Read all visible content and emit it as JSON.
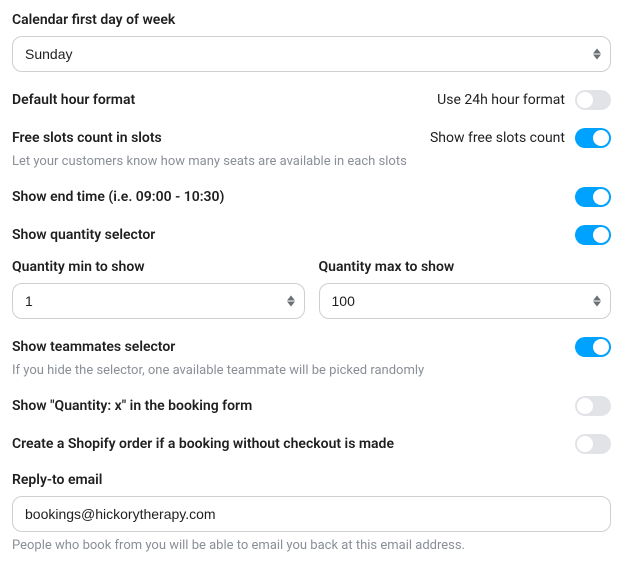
{
  "firstDay": {
    "label": "Calendar first day of week",
    "value": "Sunday"
  },
  "hourFormat": {
    "label": "Default hour format",
    "right": "Use 24h hour format",
    "on": false
  },
  "freeSlots": {
    "label": "Free slots count in slots",
    "right": "Show free slots count",
    "help": "Let your customers know how many seats are available in each slots",
    "on": true
  },
  "showEnd": {
    "label": "Show end time (i.e. 09:00 - 10:30)",
    "on": true
  },
  "showQty": {
    "label": "Show quantity selector",
    "on": true
  },
  "qtyMin": {
    "label": "Quantity min to show",
    "value": "1"
  },
  "qtyMax": {
    "label": "Quantity max to show",
    "value": "100"
  },
  "teammates": {
    "label": "Show teammates selector",
    "help": "If you hide the selector, one available teammate will be picked randomly",
    "on": true
  },
  "showQtyX": {
    "label": "Show \"Quantity: x\" in the booking form",
    "on": false
  },
  "createOrder": {
    "label": "Create a Shopify order if a booking without checkout is made",
    "on": false
  },
  "replyTo": {
    "label": "Reply-to email",
    "value": "bookings@hickorytherapy.com",
    "help": "People who book from you will be able to email you back at this email address."
  }
}
